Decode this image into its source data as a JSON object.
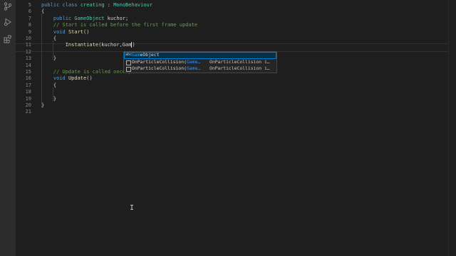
{
  "activity_bar": {
    "icons": [
      "source-control-icon",
      "run-debug-icon",
      "extensions-icon"
    ]
  },
  "editor": {
    "lines": [
      {
        "num": "5",
        "tokens": [
          {
            "t": "public ",
            "c": "kw"
          },
          {
            "t": "class ",
            "c": "kw"
          },
          {
            "t": "creating",
            "c": "ty"
          },
          {
            "t": " : ",
            "c": "pl"
          },
          {
            "t": "MonoBehaviour",
            "c": "ty"
          }
        ]
      },
      {
        "num": "6",
        "tokens": [
          {
            "t": "{",
            "c": "pl"
          }
        ]
      },
      {
        "num": "7",
        "tokens": [
          {
            "t": "    public ",
            "c": "kw"
          },
          {
            "t": "GameObject",
            "c": "ty"
          },
          {
            "t": " kuchor;",
            "c": "pl"
          }
        ]
      },
      {
        "num": "8",
        "tokens": [
          {
            "t": "    // Start is called before the first frame update",
            "c": "cm"
          }
        ]
      },
      {
        "num": "9",
        "tokens": [
          {
            "t": "    void ",
            "c": "kw"
          },
          {
            "t": "Start",
            "c": "fn"
          },
          {
            "t": "()",
            "c": "pl"
          }
        ]
      },
      {
        "num": "10",
        "tokens": [
          {
            "t": "    {",
            "c": "pl"
          }
        ]
      },
      {
        "num": "11",
        "tokens": [
          {
            "t": "        Instantiate",
            "c": "fn"
          },
          {
            "t": "(kuchor,Gam",
            "c": "pl"
          },
          {
            "t": ")",
            "c": "pl"
          }
        ]
      },
      {
        "num": "12",
        "tokens": []
      },
      {
        "num": "13",
        "tokens": [
          {
            "t": "    }",
            "c": "pl"
          }
        ]
      },
      {
        "num": "14",
        "tokens": []
      },
      {
        "num": "15",
        "tokens": [
          {
            "t": "    // Update is called once per frame",
            "c": "cm"
          }
        ]
      },
      {
        "num": "16",
        "tokens": [
          {
            "t": "    void ",
            "c": "kw"
          },
          {
            "t": "Update",
            "c": "fn"
          },
          {
            "t": "()",
            "c": "pl"
          }
        ]
      },
      {
        "num": "17",
        "tokens": [
          {
            "t": "    {",
            "c": "pl"
          }
        ]
      },
      {
        "num": "18",
        "tokens": []
      },
      {
        "num": "19",
        "tokens": [
          {
            "t": "    }",
            "c": "pl"
          }
        ]
      },
      {
        "num": "20",
        "tokens": [
          {
            "t": "}",
            "c": "pl"
          }
        ]
      },
      {
        "num": "21",
        "tokens": []
      }
    ]
  },
  "suggest": {
    "items": [
      {
        "icon": "abc",
        "match": "Gam",
        "rest": "eObject",
        "param": "",
        "detail": ""
      },
      {
        "icon": "method",
        "match": "",
        "rest": "OnParticleCollision(",
        "param": "Game…",
        "detail": "OnParticleCollision i…"
      },
      {
        "icon": "method",
        "match": "",
        "rest": "OnParticleCollision(",
        "param": "Game…",
        "detail": "OnParticleCollision i…"
      }
    ]
  }
}
